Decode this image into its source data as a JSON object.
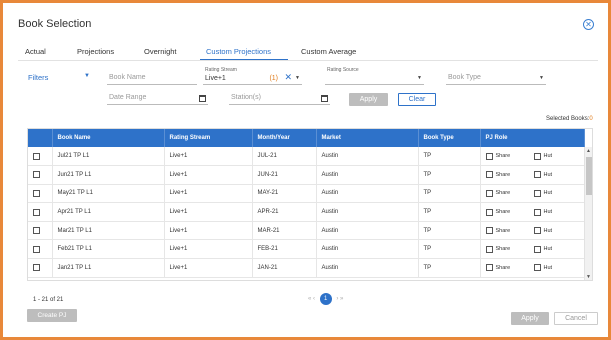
{
  "dialog": {
    "title": "Book Selection",
    "close_icon": "close-circle-icon"
  },
  "tabs": [
    {
      "label": "Actual"
    },
    {
      "label": "Projections"
    },
    {
      "label": "Overnight"
    },
    {
      "label": "Custom Projections",
      "active": true
    },
    {
      "label": "Custom Average"
    }
  ],
  "filters": {
    "label": "Filters",
    "book_name_placeholder": "Book Name",
    "rating_stream_label": "Rating Stream",
    "rating_stream_value": "Live+1",
    "rating_stream_count": "(1)",
    "rating_source_label": "Rating Source",
    "book_type_placeholder": "Book Type",
    "date_range_placeholder": "Date Range",
    "stations_placeholder": "Station(s)",
    "apply_label": "Apply",
    "clear_label": "Clear"
  },
  "selected_books": {
    "label": "Selected Books:",
    "count": "0"
  },
  "table": {
    "columns": [
      "",
      "Book Name",
      "Rating Stream",
      "Month/Year",
      "Market",
      "Book Type",
      "PJ Role"
    ],
    "share_label": "Share",
    "hut_label": "Hut",
    "rows": [
      {
        "book_name": "Jul21 TP L1",
        "rating_stream": "Live+1",
        "month_year": "JUL-21",
        "market": "Austin",
        "book_type": "TP"
      },
      {
        "book_name": "Jun21 TP L1",
        "rating_stream": "Live+1",
        "month_year": "JUN-21",
        "market": "Austin",
        "book_type": "TP"
      },
      {
        "book_name": "May21 TP L1",
        "rating_stream": "Live+1",
        "month_year": "MAY-21",
        "market": "Austin",
        "book_type": "TP"
      },
      {
        "book_name": "Apr21 TP L1",
        "rating_stream": "Live+1",
        "month_year": "APR-21",
        "market": "Austin",
        "book_type": "TP"
      },
      {
        "book_name": "Mar21 TP L1",
        "rating_stream": "Live+1",
        "month_year": "MAR-21",
        "market": "Austin",
        "book_type": "TP"
      },
      {
        "book_name": "Feb21 TP L1",
        "rating_stream": "Live+1",
        "month_year": "FEB-21",
        "market": "Austin",
        "book_type": "TP"
      },
      {
        "book_name": "Jan21 TP L1",
        "rating_stream": "Live+1",
        "month_year": "JAN-21",
        "market": "Austin",
        "book_type": "TP"
      }
    ]
  },
  "pagination": {
    "info": "1 - 21 of 21",
    "current_page": "1"
  },
  "footer": {
    "create_pj_label": "Create PJ",
    "apply_label": "Apply",
    "cancel_label": "Cancel"
  },
  "colors": {
    "accent": "#2e72c9",
    "frame": "#e8883a",
    "count": "#e07b1a",
    "disabled": "#bdbdbd"
  }
}
